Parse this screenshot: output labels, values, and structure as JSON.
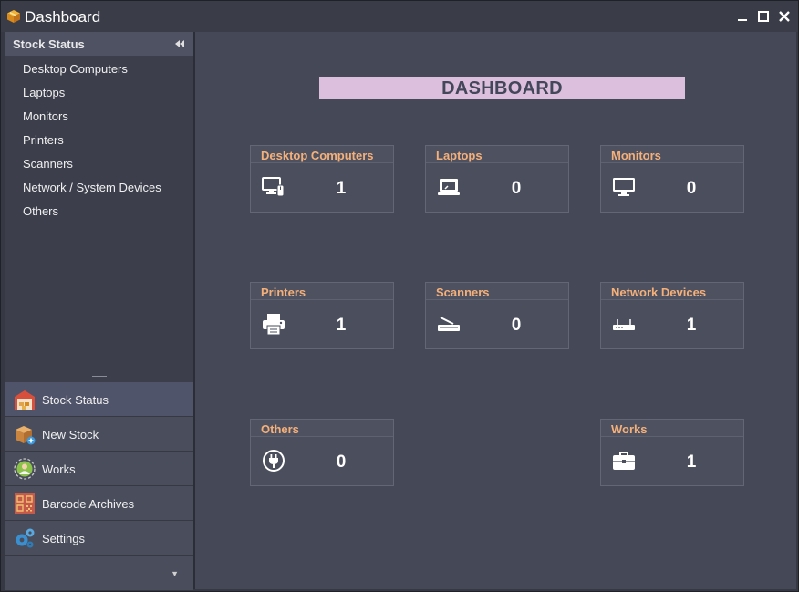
{
  "window": {
    "title": "Dashboard"
  },
  "sidebar": {
    "group_title": "Stock Status",
    "items": [
      {
        "label": "Desktop Computers"
      },
      {
        "label": "Laptops"
      },
      {
        "label": "Monitors"
      },
      {
        "label": "Printers"
      },
      {
        "label": "Scanners"
      },
      {
        "label": "Network / System Devices"
      },
      {
        "label": "Others"
      }
    ]
  },
  "bottom_nav": [
    {
      "label": "Stock Status",
      "icon": "warehouse-icon"
    },
    {
      "label": "New Stock",
      "icon": "new-stock-box-icon"
    },
    {
      "label": "Works",
      "icon": "works-person-icon"
    },
    {
      "label": "Barcode Archives",
      "icon": "barcode-archive-icon"
    },
    {
      "label": "Settings",
      "icon": "gears-icon"
    }
  ],
  "dashboard": {
    "title": "DASHBOARD",
    "cards": [
      {
        "label": "Desktop Computers",
        "value": "1",
        "icon": "desktop-computer-icon"
      },
      {
        "label": "Laptops",
        "value": "0",
        "icon": "laptop-icon"
      },
      {
        "label": "Monitors",
        "value": "0",
        "icon": "monitor-icon"
      },
      {
        "label": "Printers",
        "value": "1",
        "icon": "printer-icon"
      },
      {
        "label": "Scanners",
        "value": "0",
        "icon": "scanner-icon"
      },
      {
        "label": "Network Devices",
        "value": "1",
        "icon": "router-icon"
      },
      {
        "label": "Others",
        "value": "0",
        "icon": "power-plug-icon"
      },
      {
        "label": "Works",
        "value": "1",
        "icon": "briefcase-icon"
      }
    ]
  },
  "colors": {
    "card_header_text": "#f5b07a",
    "title_banner": "#dcbfdc",
    "main_background": "#454857",
    "sidebar_background": "#3c3f4b"
  }
}
